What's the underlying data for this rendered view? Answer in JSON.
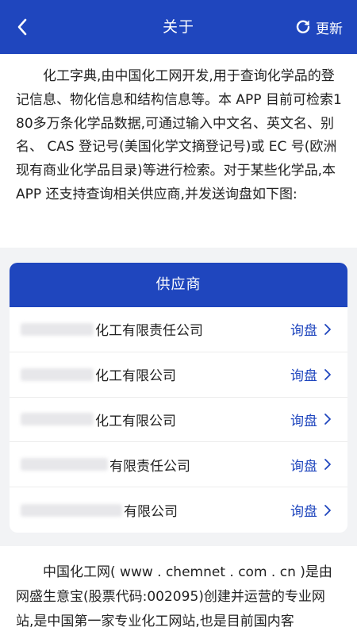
{
  "header": {
    "title": "关于",
    "back_icon": "chevron-left-icon",
    "update_label": "更新",
    "update_icon": "refresh-icon",
    "background_color": "#1f46be"
  },
  "intro": {
    "text": "化工字典,由中国化工网开发,用于查询化学品的登记信息、物化信息和结构信息等。本 APP 目前可检索180多万条化学品数据,可通过输入中文名、英文名、别名、 CAS 登记号(美国化学文摘登记号)或 EC 号(欧洲现有商业化学品目录)等进行检索。对于某些化学品,本 APP 还支持查询相关供应商,并发送询盘如下图:"
  },
  "suppliers": {
    "title": "供应商",
    "inquiry_label": "询盘",
    "items": [
      {
        "name": "化工有限责任公司"
      },
      {
        "name": "化工有限公司"
      },
      {
        "name": "化工有限公司"
      },
      {
        "name": "有限责任公司"
      },
      {
        "name": "有限公司"
      }
    ]
  },
  "footer": {
    "text": "中国化工网( www . chemnet . com . cn )是由网盛生意宝(股票代码:002095)创建并运营的专业网站,是中国第一家专业化工网站,也是目前国内客"
  }
}
